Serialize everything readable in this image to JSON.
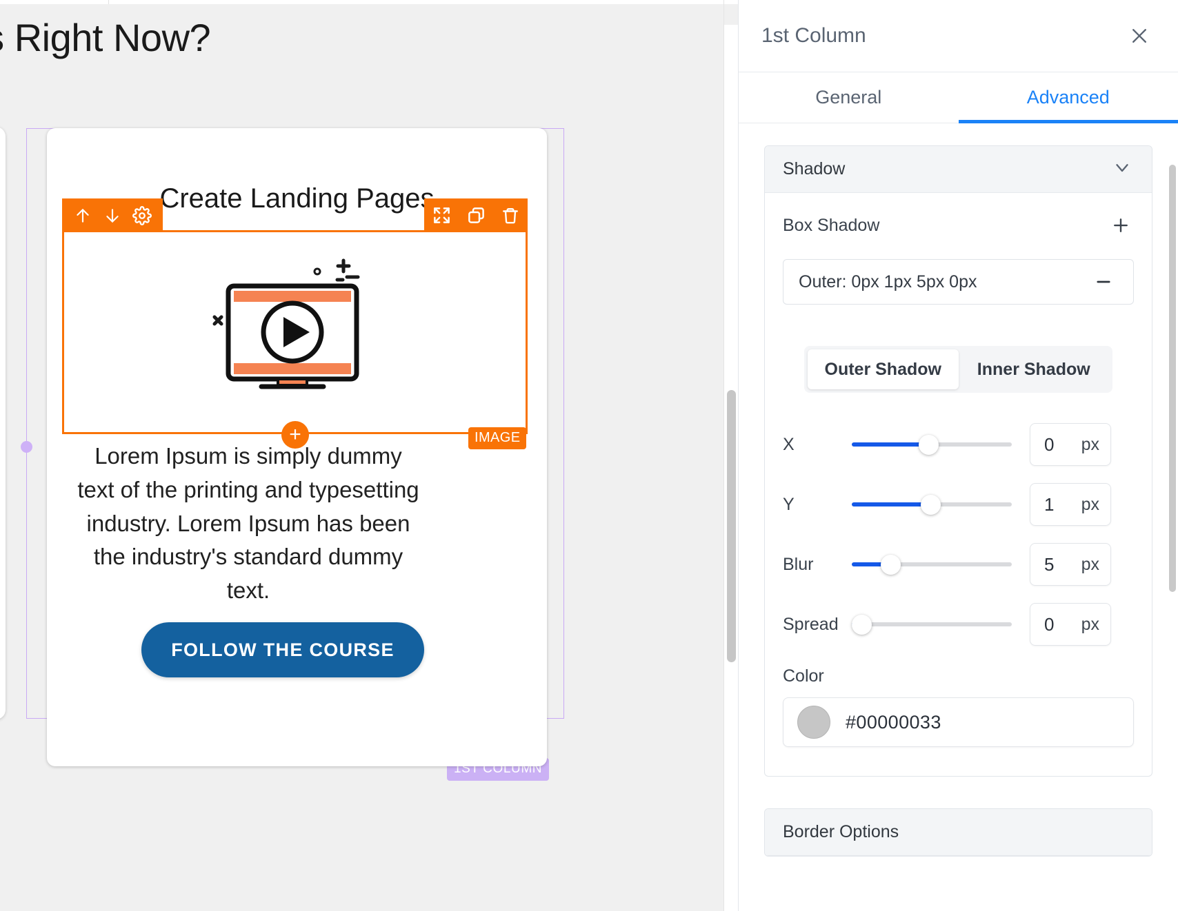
{
  "canvas": {
    "hero_heading": "ess Right Now?",
    "card": {
      "title": "Create Landing Pages",
      "body": "Lorem Ipsum is simply dummy text of the printing and typesetting industry. Lorem Ipsum has been the industry's standard dummy text.",
      "cta_label": "FOLLOW THE COURSE"
    },
    "badges": {
      "image": "IMAGE",
      "column": "1ST COLUMN"
    },
    "toolbar": {
      "move_up": "move-up",
      "move_down": "move-down",
      "settings": "settings",
      "expand": "expand",
      "duplicate": "duplicate",
      "delete": "delete"
    },
    "add_handle": "+",
    "accent_orange": "#f97306",
    "accent_purple": "#cbb1f5",
    "cta_blue": "#14619f"
  },
  "panel": {
    "title": "1st Column",
    "close_label": "close",
    "tabs": [
      {
        "label": "General",
        "active": false
      },
      {
        "label": "Advanced",
        "active": true
      }
    ],
    "accent_blue": "#1a82f7",
    "shadow_section": {
      "header": "Shadow",
      "box_shadow_label": "Box Shadow",
      "add_label": "+",
      "entries": [
        {
          "label": "Outer: 0px 1px 5px 0px",
          "remove_label": "—"
        }
      ],
      "segmented": [
        {
          "label": "Outer Shadow",
          "active": true
        },
        {
          "label": "Inner Shadow",
          "active": false
        }
      ],
      "sliders": [
        {
          "label": "X",
          "value": "0",
          "unit": "px",
          "percent": 48
        },
        {
          "label": "Y",
          "value": "1",
          "unit": "px",
          "percent": 49
        },
        {
          "label": "Blur",
          "value": "5",
          "unit": "px",
          "percent": 24
        },
        {
          "label": "Spread",
          "value": "0",
          "unit": "px",
          "percent": 2
        }
      ],
      "color_label": "Color",
      "color_value": "#00000033",
      "color_swatch": "#c6c6c6"
    },
    "border_section": {
      "header": "Border Options"
    }
  }
}
